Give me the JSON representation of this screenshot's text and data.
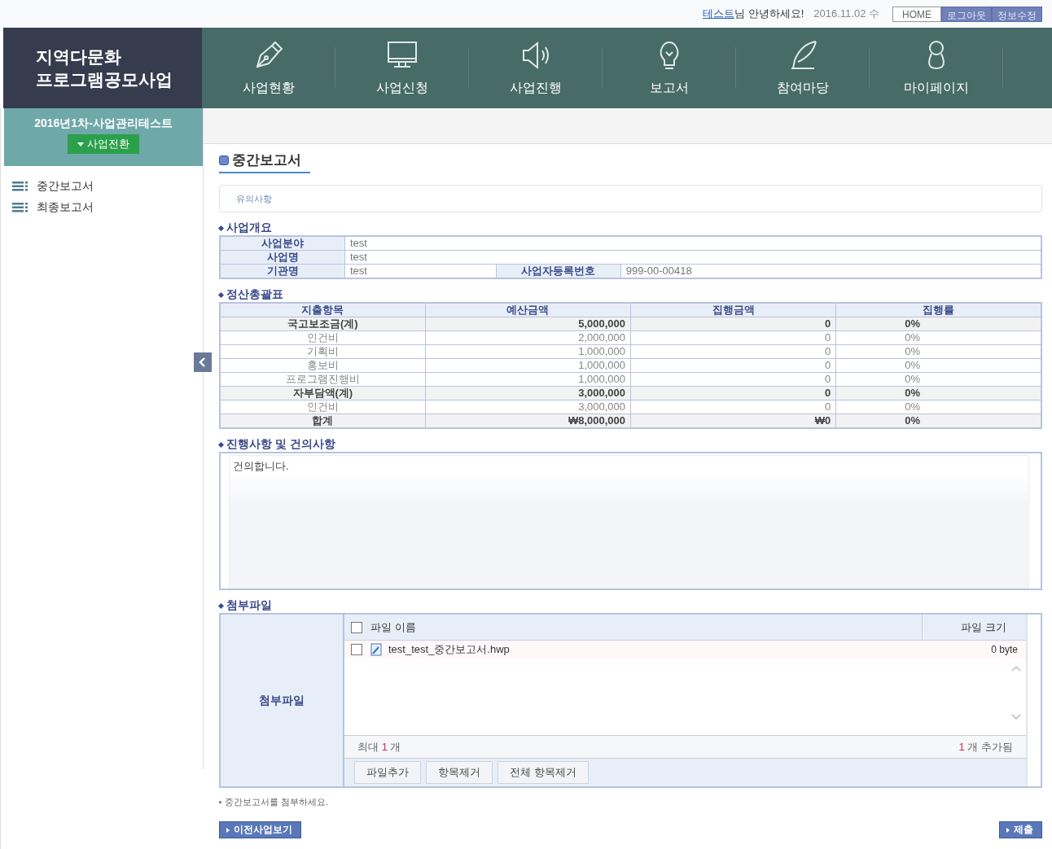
{
  "top_bar": {
    "user_link": "테스트",
    "greeting": "님 안녕하세요!",
    "date": "2016.11.02 수",
    "buttons": [
      {
        "label": "HOME",
        "kind": "outline"
      },
      {
        "label": "로그아웃",
        "kind": "filled"
      },
      {
        "label": "정보수정",
        "kind": "filled"
      }
    ]
  },
  "logo": {
    "lines": [
      "지역다문화",
      "프로그램공모사업"
    ]
  },
  "nav": {
    "items": [
      {
        "label": "사업현황",
        "kind": "pen"
      },
      {
        "label": "사업신청",
        "kind": "monitor"
      },
      {
        "label": "사업진행",
        "kind": "speaker"
      },
      {
        "label": "보고서",
        "kind": "bulb"
      },
      {
        "label": "참여마당",
        "kind": "quill"
      },
      {
        "label": "마이페이지",
        "kind": "person"
      }
    ]
  },
  "sidebar": {
    "project": "2016년1차-사업관리테스트",
    "switch_button": "사업전환",
    "items": [
      {
        "label": "중간보고서"
      },
      {
        "label": "최종보고서"
      }
    ]
  },
  "page_title": "중간보고서",
  "notice": "유의사항",
  "overview": {
    "title": "사업개요",
    "rows": [
      {
        "label": "사업분야",
        "value": "test"
      },
      {
        "label": "사업명",
        "value": "test"
      },
      {
        "label": "기관명",
        "value": "test",
        "extra_label": "사업자등록번호",
        "extra_value": "999-00-00418"
      }
    ]
  },
  "settlement": {
    "title": "정산총괄표",
    "columns": [
      "지출항목",
      "예산금액",
      "집행금액",
      "집행률"
    ],
    "rows": [
      {
        "kind": "subtotal",
        "cells": [
          "국고보조금(계)",
          "5,000,000",
          "0",
          "0%"
        ]
      },
      {
        "kind": "item",
        "cells": [
          "인건비",
          "2,000,000",
          "0",
          "0%"
        ]
      },
      {
        "kind": "item",
        "cells": [
          "기획비",
          "1,000,000",
          "0",
          "0%"
        ]
      },
      {
        "kind": "item",
        "cells": [
          "홍보비",
          "1,000,000",
          "0",
          "0%"
        ]
      },
      {
        "kind": "item",
        "cells": [
          "프로그램진행비",
          "1,000,000",
          "0",
          "0%"
        ]
      },
      {
        "kind": "subtotal",
        "cells": [
          "자부담액(계)",
          "3,000,000",
          "0",
          "0%"
        ]
      },
      {
        "kind": "item",
        "cells": [
          "인건비",
          "3,000,000",
          "0",
          "0%"
        ]
      },
      {
        "kind": "subtotal",
        "cells": [
          "합계",
          "₩8,000,000",
          "₩0",
          "0%"
        ]
      }
    ]
  },
  "progress": {
    "title": "진행사항 및 건의사항",
    "value": "건의합니다."
  },
  "attachments": {
    "title": "첨부파일",
    "label": "첨부파일",
    "all_checked": false,
    "columns": [
      "파일 이름",
      "파일 크기"
    ],
    "files": [
      {
        "name": "test_test_중간보고서.hwp",
        "size": "0 byte",
        "checked": false
      }
    ],
    "limit_label": "최대",
    "limit_count": "1",
    "limit_unit": "개",
    "added_count": "1",
    "added_label": "개 추가됨",
    "buttons": [
      "파일추가",
      "항목제거",
      "전체 항목제거"
    ]
  },
  "footnote": "중간보고서를 첨부하세요.",
  "bottom_buttons": [
    "이전사업보기",
    "제출"
  ]
}
